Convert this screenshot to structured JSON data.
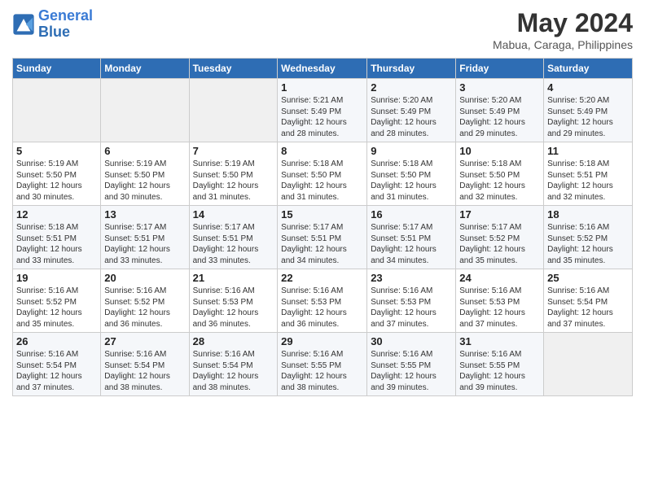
{
  "header": {
    "logo_line1": "General",
    "logo_line2": "Blue",
    "month_year": "May 2024",
    "location": "Mabua, Caraga, Philippines"
  },
  "weekdays": [
    "Sunday",
    "Monday",
    "Tuesday",
    "Wednesday",
    "Thursday",
    "Friday",
    "Saturday"
  ],
  "weeks": [
    [
      {
        "day": "",
        "info": ""
      },
      {
        "day": "",
        "info": ""
      },
      {
        "day": "",
        "info": ""
      },
      {
        "day": "1",
        "info": "Sunrise: 5:21 AM\nSunset: 5:49 PM\nDaylight: 12 hours\nand 28 minutes."
      },
      {
        "day": "2",
        "info": "Sunrise: 5:20 AM\nSunset: 5:49 PM\nDaylight: 12 hours\nand 28 minutes."
      },
      {
        "day": "3",
        "info": "Sunrise: 5:20 AM\nSunset: 5:49 PM\nDaylight: 12 hours\nand 29 minutes."
      },
      {
        "day": "4",
        "info": "Sunrise: 5:20 AM\nSunset: 5:49 PM\nDaylight: 12 hours\nand 29 minutes."
      }
    ],
    [
      {
        "day": "5",
        "info": "Sunrise: 5:19 AM\nSunset: 5:50 PM\nDaylight: 12 hours\nand 30 minutes."
      },
      {
        "day": "6",
        "info": "Sunrise: 5:19 AM\nSunset: 5:50 PM\nDaylight: 12 hours\nand 30 minutes."
      },
      {
        "day": "7",
        "info": "Sunrise: 5:19 AM\nSunset: 5:50 PM\nDaylight: 12 hours\nand 31 minutes."
      },
      {
        "day": "8",
        "info": "Sunrise: 5:18 AM\nSunset: 5:50 PM\nDaylight: 12 hours\nand 31 minutes."
      },
      {
        "day": "9",
        "info": "Sunrise: 5:18 AM\nSunset: 5:50 PM\nDaylight: 12 hours\nand 31 minutes."
      },
      {
        "day": "10",
        "info": "Sunrise: 5:18 AM\nSunset: 5:50 PM\nDaylight: 12 hours\nand 32 minutes."
      },
      {
        "day": "11",
        "info": "Sunrise: 5:18 AM\nSunset: 5:51 PM\nDaylight: 12 hours\nand 32 minutes."
      }
    ],
    [
      {
        "day": "12",
        "info": "Sunrise: 5:18 AM\nSunset: 5:51 PM\nDaylight: 12 hours\nand 33 minutes."
      },
      {
        "day": "13",
        "info": "Sunrise: 5:17 AM\nSunset: 5:51 PM\nDaylight: 12 hours\nand 33 minutes."
      },
      {
        "day": "14",
        "info": "Sunrise: 5:17 AM\nSunset: 5:51 PM\nDaylight: 12 hours\nand 33 minutes."
      },
      {
        "day": "15",
        "info": "Sunrise: 5:17 AM\nSunset: 5:51 PM\nDaylight: 12 hours\nand 34 minutes."
      },
      {
        "day": "16",
        "info": "Sunrise: 5:17 AM\nSunset: 5:51 PM\nDaylight: 12 hours\nand 34 minutes."
      },
      {
        "day": "17",
        "info": "Sunrise: 5:17 AM\nSunset: 5:52 PM\nDaylight: 12 hours\nand 35 minutes."
      },
      {
        "day": "18",
        "info": "Sunrise: 5:16 AM\nSunset: 5:52 PM\nDaylight: 12 hours\nand 35 minutes."
      }
    ],
    [
      {
        "day": "19",
        "info": "Sunrise: 5:16 AM\nSunset: 5:52 PM\nDaylight: 12 hours\nand 35 minutes."
      },
      {
        "day": "20",
        "info": "Sunrise: 5:16 AM\nSunset: 5:52 PM\nDaylight: 12 hours\nand 36 minutes."
      },
      {
        "day": "21",
        "info": "Sunrise: 5:16 AM\nSunset: 5:53 PM\nDaylight: 12 hours\nand 36 minutes."
      },
      {
        "day": "22",
        "info": "Sunrise: 5:16 AM\nSunset: 5:53 PM\nDaylight: 12 hours\nand 36 minutes."
      },
      {
        "day": "23",
        "info": "Sunrise: 5:16 AM\nSunset: 5:53 PM\nDaylight: 12 hours\nand 37 minutes."
      },
      {
        "day": "24",
        "info": "Sunrise: 5:16 AM\nSunset: 5:53 PM\nDaylight: 12 hours\nand 37 minutes."
      },
      {
        "day": "25",
        "info": "Sunrise: 5:16 AM\nSunset: 5:54 PM\nDaylight: 12 hours\nand 37 minutes."
      }
    ],
    [
      {
        "day": "26",
        "info": "Sunrise: 5:16 AM\nSunset: 5:54 PM\nDaylight: 12 hours\nand 37 minutes."
      },
      {
        "day": "27",
        "info": "Sunrise: 5:16 AM\nSunset: 5:54 PM\nDaylight: 12 hours\nand 38 minutes."
      },
      {
        "day": "28",
        "info": "Sunrise: 5:16 AM\nSunset: 5:54 PM\nDaylight: 12 hours\nand 38 minutes."
      },
      {
        "day": "29",
        "info": "Sunrise: 5:16 AM\nSunset: 5:55 PM\nDaylight: 12 hours\nand 38 minutes."
      },
      {
        "day": "30",
        "info": "Sunrise: 5:16 AM\nSunset: 5:55 PM\nDaylight: 12 hours\nand 39 minutes."
      },
      {
        "day": "31",
        "info": "Sunrise: 5:16 AM\nSunset: 5:55 PM\nDaylight: 12 hours\nand 39 minutes."
      },
      {
        "day": "",
        "info": ""
      }
    ]
  ]
}
